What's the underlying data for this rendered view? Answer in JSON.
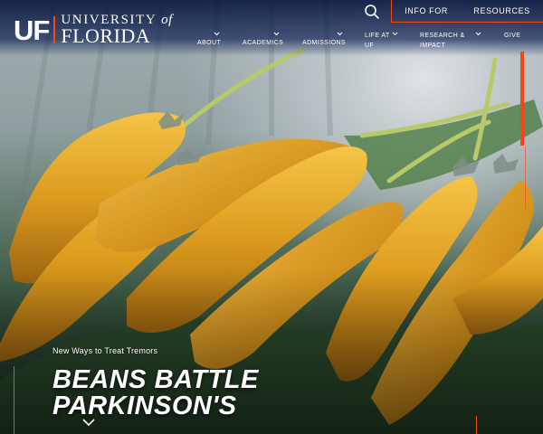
{
  "brand": {
    "mark": "UF",
    "line1": "UNIVERSITY",
    "line1_of": "of",
    "line2": "FLORIDA"
  },
  "utility_nav": {
    "search_icon": "search-icon",
    "items": [
      "INFO FOR",
      "RESOURCES"
    ]
  },
  "main_nav": {
    "items": [
      {
        "label": "ABOUT",
        "label2": ""
      },
      {
        "label": "ACADEMICS",
        "label2": ""
      },
      {
        "label": "ADMISSIONS",
        "label2": ""
      },
      {
        "label": "LIFE AT",
        "label2": "UF"
      },
      {
        "label": "RESEARCH &",
        "label2": "IMPACT"
      },
      {
        "label": "GIVE",
        "label2": ""
      }
    ]
  },
  "hero": {
    "kicker": "New Ways to Treat Tremors",
    "headline_line1": "BEANS BATTLE",
    "headline_line2": "PARKINSON'S",
    "scroll_icon": "chevron-down-icon"
  },
  "colors": {
    "accent": "#fa4616",
    "navy": "#0021a5",
    "bean": "#e0a326"
  }
}
